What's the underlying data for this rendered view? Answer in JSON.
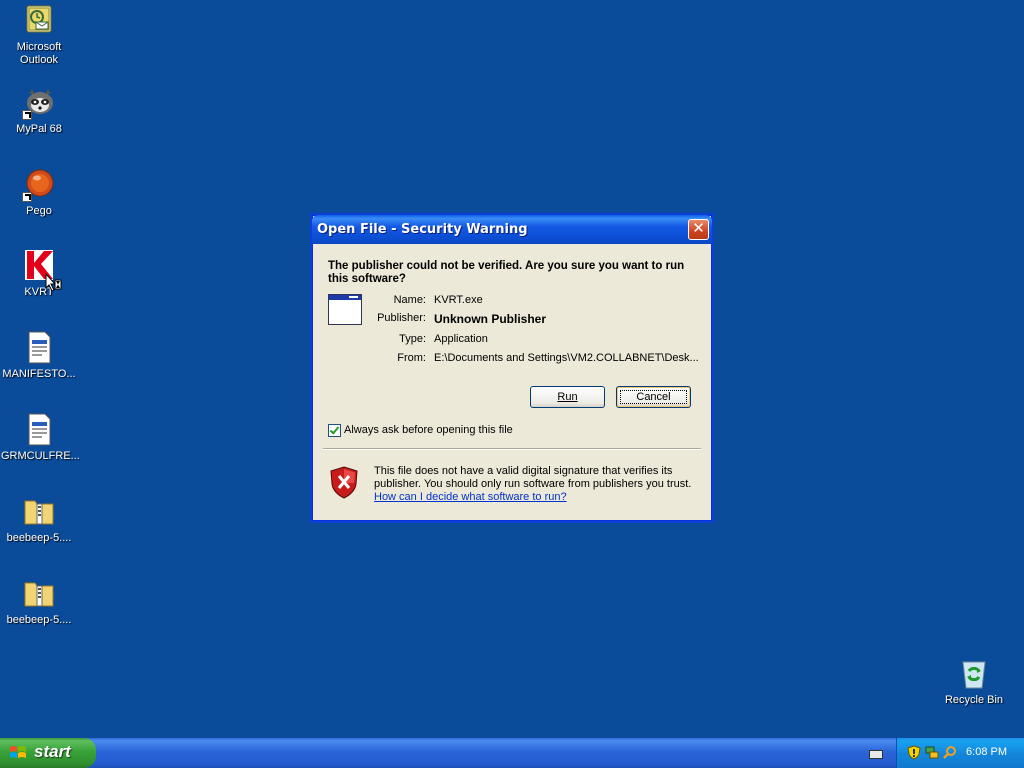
{
  "desktop": {
    "icons": [
      {
        "label": "Microsoft Outlook"
      },
      {
        "label": "MyPal 68"
      },
      {
        "label": "Pego"
      },
      {
        "label": "KVRT"
      },
      {
        "label": "MANIFESTO..."
      },
      {
        "label": "GRMCULFRE..."
      },
      {
        "label": "beebeep-5...."
      },
      {
        "label": "beebeep-5...."
      },
      {
        "label": "Recycle Bin"
      }
    ]
  },
  "dialog": {
    "title": "Open File - Security Warning",
    "close_label": "✕",
    "question": "The publisher could not be verified.  Are you sure you want to run this software?",
    "fields": [
      {
        "label": "Name:",
        "value": "KVRT.exe"
      },
      {
        "label": "Publisher:",
        "value": "Unknown Publisher"
      },
      {
        "label": "Type:",
        "value": "Application"
      },
      {
        "label": "From:",
        "value": "E:\\Documents and Settings\\VM2.COLLABNET\\Desk..."
      }
    ],
    "run_label": "Run",
    "cancel_label": "Cancel",
    "checkbox_label": "Always ask before opening this file",
    "checkbox_checked": true,
    "warning_text": "This file does not have a valid digital signature that verifies its publisher.  You should only run software from publishers you trust.",
    "help_link": "How can I decide what software to run?"
  },
  "taskbar": {
    "start_label": "start",
    "clock": "6:08 PM"
  },
  "colors": {
    "desktop": "#0a4b9a",
    "dialog_bg": "#ece9d8",
    "title_blue": "#0c4fd6",
    "start_green": "#38a238",
    "link": "#0033cc"
  }
}
